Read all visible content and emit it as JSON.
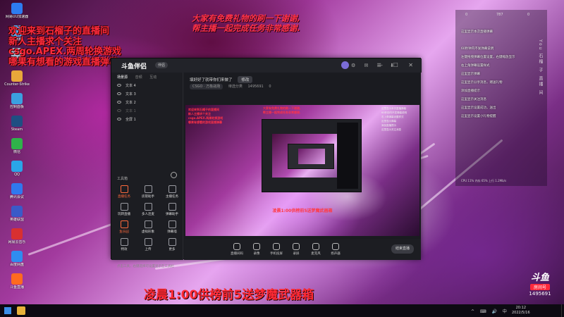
{
  "overlays": {
    "left_lines": [
      "欢迎来到石榴子的直播间",
      "新人主播求个关注",
      "csgo.APEX.两周轮换游戏",
      "哪果有想看的游戏直播弹幕"
    ],
    "top_lines": [
      "大家有免费礼物的刷一下谢谢,",
      "帮主播一起完成任务非常感谢."
    ],
    "bottom_line": "凌晨1:00供榜前5送梦魔武器箱",
    "preview_caption": "凌晨1:00供榜前5送梦魔武器箱"
  },
  "desktop_icons": [
    {
      "label": "网易UU加速器",
      "color": "#2d7cf0"
    },
    {
      "label": "此电脑",
      "color": "#58a6e8"
    },
    {
      "label": "回收站",
      "color": "#9fb8cf"
    },
    {
      "label": "Counter-Strike",
      "color": "#e8a83a"
    },
    {
      "label": "控制面板",
      "color": "#3ba0e0"
    },
    {
      "label": "Steam",
      "color": "#1f4e82"
    },
    {
      "label": "微信",
      "color": "#2fb34a"
    },
    {
      "label": "QQ",
      "color": "#2aa5e8"
    },
    {
      "label": "腾讯会议",
      "color": "#3078ee"
    },
    {
      "label": "英雄联盟",
      "color": "#3a5ac8"
    },
    {
      "label": "网易云音乐",
      "color": "#d83030"
    },
    {
      "label": "百度网盘",
      "color": "#2f8cf0"
    },
    {
      "label": "斗鱼直播",
      "color": "#ff6a1f"
    }
  ],
  "app": {
    "logo": "斗鱼伴侣",
    "badge": "伴侣",
    "title_icons": "⚙ ✉ ☰ ⬇",
    "window_controls": "— ☐ ✕",
    "tabs": [
      "场景源",
      "音频",
      "互动"
    ],
    "scenes": [
      "文本 4",
      "文本 3",
      "文本 2",
      "文本 1",
      "全屏 1"
    ],
    "tools_title": "工具箱",
    "tools": [
      {
        "label": "直播任务",
        "hot": true
      },
      {
        "label": "房管助手",
        "hot": false
      },
      {
        "label": "主播任务",
        "hot": false
      },
      {
        "label": "玩转直播",
        "hot": false
      },
      {
        "label": "多人连麦",
        "hot": false
      },
      {
        "label": "弹幕助手",
        "hot": false
      },
      {
        "label": "鱼乐园",
        "hot": true
      },
      {
        "label": "虚拟形象",
        "hot": false
      },
      {
        "label": "弹幕墙",
        "hot": false
      },
      {
        "label": "特效",
        "hot": false
      },
      {
        "label": "上传",
        "hot": false
      },
      {
        "label": "更多",
        "hot": false
      }
    ],
    "footer_note": "点击工具，右键选择可设置显示在工具栏",
    "note_text": "填好好了就带你们来做了",
    "note_button": "修改",
    "meta": {
      "game": "CSGO · 万象战场",
      "category": "待选分类",
      "room": "1495691",
      "heat": "0"
    },
    "bottom_controls": [
      "直播间码",
      "录像",
      "手机投屏",
      "录屏",
      "麦克风",
      "扬声器"
    ],
    "start_label": "结束直播"
  },
  "chat": {
    "counts": {
      "likes": "0",
      "viewers": "787",
      "gifts": "0"
    },
    "lines": [
      "这里显示本次直播弹幕",
      "",
      "60秒钟内不发弹幕说明",
      "左键拖拽弹幕位置设置，右键缩放显示",
      "右上角弹幕设置样式",
      "这里显示弹幕",
      "这里显示分享消息，赠送礼物",
      "添加直播提示",
      "这里显示关注消息",
      "这里显示设置成功，送出",
      "这里显示设置小礼物提醒"
    ],
    "vertical_text": "You 石榴 子 直播 间",
    "footer": "CPU 11%  内存 65%  上行 1.2Mb/s"
  },
  "watermark": {
    "logo": "斗鱼",
    "name": "房间号",
    "number": "1495691"
  },
  "taskbar": {
    "tray": "^ ⌨ 🔊 中",
    "time": "20:12",
    "date": "2022/5/16"
  }
}
